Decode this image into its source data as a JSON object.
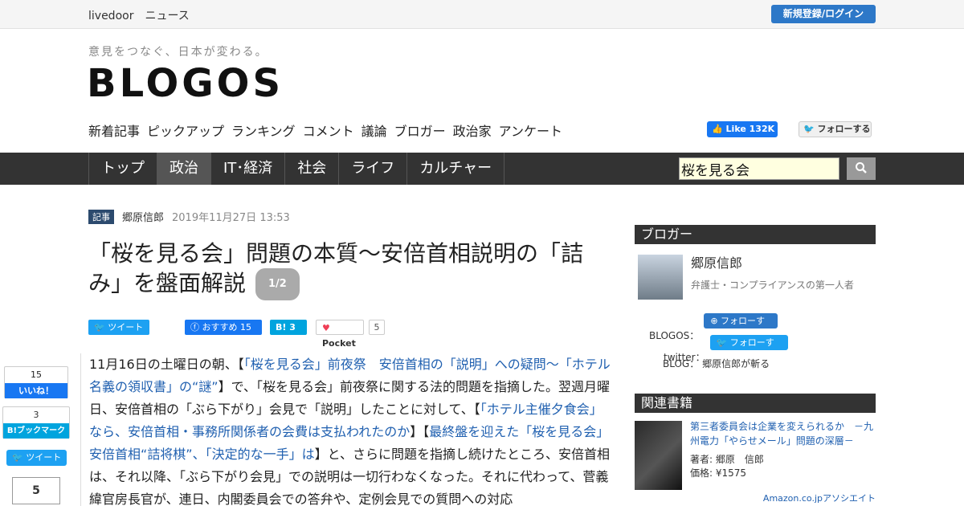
{
  "topbar": {
    "brand": "livedoor　ニュース",
    "login": "新規登録/ログイン"
  },
  "site": {
    "tagline": "意見をつなぐ、日本が変わる。",
    "logo": "BLOGOS"
  },
  "subnav": [
    "新着記事",
    "ピックアップ",
    "ランキング",
    "コメント",
    "議論",
    "ブロガー",
    "政治家",
    "アンケート"
  ],
  "social_top": {
    "fb_like": "Like 132K",
    "tw_follow": "フォローする"
  },
  "mainnav": {
    "tabs": [
      "トップ",
      "政治",
      "IT･経済",
      "社会",
      "ライフ",
      "カルチャー"
    ],
    "active": "政治"
  },
  "search": {
    "value": "桜を見る会"
  },
  "article": {
    "tag": "記事",
    "author": "郷原信郎",
    "date": "2019年11月27日 13:53",
    "title": "「桜を見る会」問題の本質～安倍首相説明の「詰み」を盤面解説",
    "page": "1/2",
    "share": {
      "tweet": "ツイート",
      "fb": "おすすめ 15",
      "hb": "B! 3",
      "pocket": "Pocket",
      "pocket_count": "5"
    },
    "body": {
      "p1": "11月16日の土曜日の朝、【",
      "l1": "「桜を見る会」前夜祭　安倍首相の「説明」への疑問～「ホテル名義の領収書」の“謎”",
      "p2": "】で、「桜を見る会」前夜祭に関する法的問題を指摘した。翌週月曜日、安倍首相の「ぶら下がり」会見で「説明」したことに対して、【",
      "l2": "「ホテル主催夕食会」なら、安倍首相・事務所関係者の会費は支払われたのか",
      "p3": "】【",
      "l3": "最終盤を迎えた「桜を見る会」安倍首相“詰将棋”、「決定的な一手」は",
      "p4": "】と、さらに問題を指摘し続けたところ、安倍首相は、それ以降、「ぶら下がり会見」での説明は一切行わなくなった。それに代わって、菅義緯官房長官が、連日、内閣委員会での答弁や、定例会見での質問への対応"
    }
  },
  "left_social": {
    "fb_count": "15",
    "fb_label": "いいね！",
    "hb_count": "3",
    "hb_label": "B!ブックマーク",
    "tweet": "ツイート",
    "pocket": "5"
  },
  "sidebar": {
    "blogger_head": "ブロガー",
    "blogger_name": "郷原信郎",
    "blogger_desc": "弁護士・コンプライアンスの第一人者",
    "blogos_label": "BLOGOS：",
    "blogos_btn": "フォローする",
    "twitter_label": "twitter：",
    "twitter_btn": "フォローする",
    "blog_label": "BLOG：",
    "blog_value": "郷原信郎が斬る",
    "books_head": "関連書籍",
    "book_title": "第三者委員会は企業を変えられるか　－九州電力「やらせメール」問題の深層－",
    "book_author": "著者: 郷原　信郎",
    "book_price": "価格: ¥1575",
    "amazon": "Amazon.co.jpアソシエイト"
  }
}
